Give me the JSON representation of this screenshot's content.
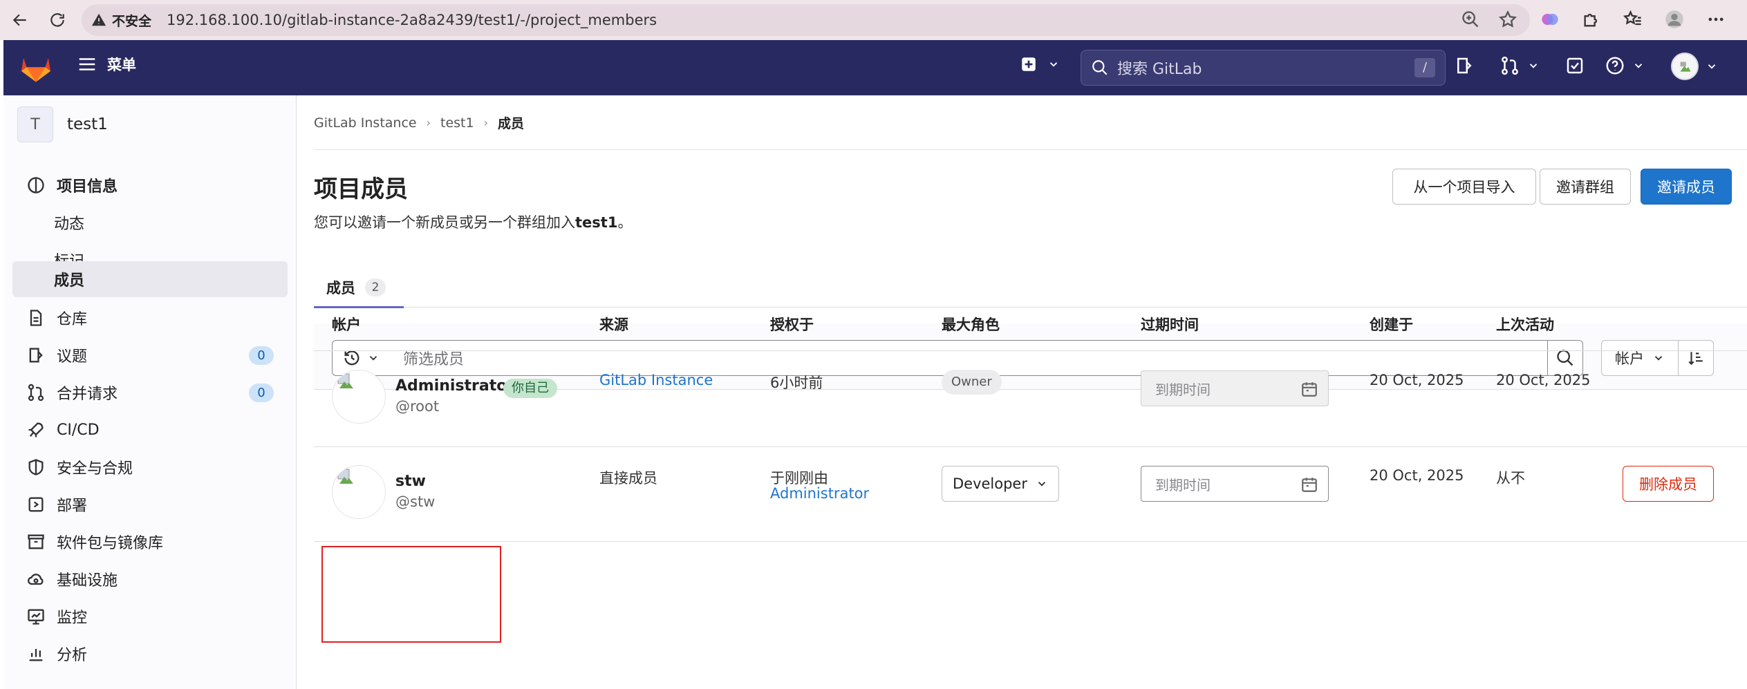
{
  "browser": {
    "security_label": "不安全",
    "url": "192.168.100.10/gitlab-instance-2a8a2439/test1/-/project_members"
  },
  "header": {
    "menu_label": "菜单",
    "search_placeholder": "搜索 GitLab",
    "search_shortcut": "/"
  },
  "sidebar": {
    "project_initial": "T",
    "project_name": "test1",
    "items": [
      {
        "label": "项目信息",
        "icon": "info-icon"
      },
      {
        "label": "动态"
      },
      {
        "label": "标记"
      },
      {
        "label": "成员"
      },
      {
        "label": "仓库",
        "icon": "file-icon"
      },
      {
        "label": "议题",
        "icon": "issues-icon",
        "count": "0"
      },
      {
        "label": "合并请求",
        "icon": "merge-request-icon",
        "count": "0"
      },
      {
        "label": "CI/CD",
        "icon": "rocket-icon"
      },
      {
        "label": "安全与合规",
        "icon": "shield-icon"
      },
      {
        "label": "部署",
        "icon": "deploy-icon"
      },
      {
        "label": "软件包与镜像库",
        "icon": "package-icon"
      },
      {
        "label": "基础设施",
        "icon": "cloud-icon"
      },
      {
        "label": "监控",
        "icon": "monitor-icon"
      },
      {
        "label": "分析",
        "icon": "chart-icon"
      }
    ]
  },
  "breadcrumb": {
    "items": [
      "GitLab Instance",
      "test1",
      "成员"
    ]
  },
  "page": {
    "title": "项目成员",
    "desc_prefix": "您可以邀请一个新成员或另一个群组加入",
    "desc_project": "test1",
    "desc_suffix": "。",
    "btn_import": "从一个项目导入",
    "btn_invite_group": "邀请群组",
    "btn_invite_member": "邀请成员"
  },
  "tabs": {
    "members_label": "成员",
    "members_count": "2"
  },
  "filter": {
    "placeholder": "筛选成员",
    "sort_label": "帐户"
  },
  "table": {
    "headers": [
      "帐户",
      "来源",
      "授权于",
      "最大角色",
      "过期时间",
      "创建于",
      "上次活动"
    ],
    "rows": [
      {
        "name": "Administrator",
        "you_badge": "你自己",
        "username": "@root",
        "source": "GitLab Instance",
        "granted": "6小时前",
        "role": "Owner",
        "expiry_placeholder": "到期时间",
        "created": "20 Oct, 2025",
        "last_activity": "20 Oct, 2025"
      },
      {
        "name": "stw",
        "username": "@stw",
        "source": "直接成员",
        "granted_line1": "于刚刚由",
        "granted_by": "Administrator",
        "role": "Developer",
        "expiry_placeholder": "到期时间",
        "created": "20 Oct, 2025",
        "last_activity": "从不",
        "remove_label": "删除成员"
      }
    ]
  }
}
